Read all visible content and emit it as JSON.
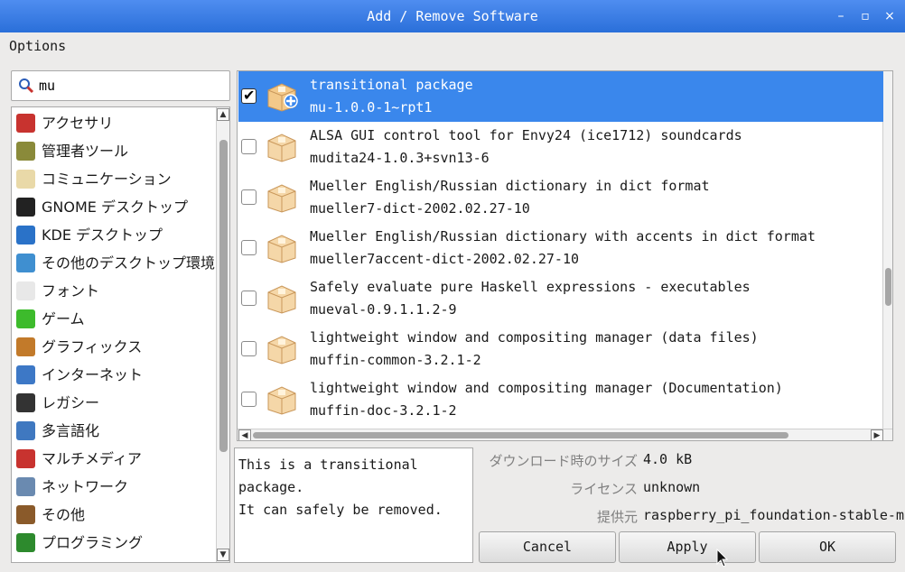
{
  "window": {
    "title": "Add / Remove Software",
    "minimize": "–",
    "maximize": "▫",
    "close": "×"
  },
  "menu": {
    "options": "Options"
  },
  "search": {
    "value": "mu"
  },
  "categories": [
    {
      "label": "アクセサリ",
      "icon": "pocket-knife-icon",
      "color": "#c8332f"
    },
    {
      "label": "管理者ツール",
      "icon": "admin-tools-icon",
      "color": "#8a8a3a"
    },
    {
      "label": "コミュニケーション",
      "icon": "communication-icon",
      "color": "#e9d9a8"
    },
    {
      "label": "GNOME デスクトップ",
      "icon": "gnome-foot-icon",
      "color": "#222222"
    },
    {
      "label": "KDE デスクトップ",
      "icon": "kde-icon",
      "color": "#2a72c8"
    },
    {
      "label": "その他のデスクトップ環境",
      "icon": "desktop-icon",
      "color": "#3f8fd0"
    },
    {
      "label": "フォント",
      "icon": "font-icon",
      "color": "#e8e8e8"
    },
    {
      "label": "ゲーム",
      "icon": "game-invader-icon",
      "color": "#3dbb2c"
    },
    {
      "label": "グラフィックス",
      "icon": "brush-icon",
      "color": "#c27a2a"
    },
    {
      "label": "インターネット",
      "icon": "globe-icon",
      "color": "#3d78c6"
    },
    {
      "label": "レガシー",
      "icon": "floppy-disk-icon",
      "color": "#333333"
    },
    {
      "label": "多言語化",
      "icon": "flag-icon",
      "color": "#3f78c0"
    },
    {
      "label": "マルチメディア",
      "icon": "popcorn-icon",
      "color": "#c8332f"
    },
    {
      "label": "ネットワーク",
      "icon": "network-icon",
      "color": "#6a8ab0"
    },
    {
      "label": "その他",
      "icon": "box-icon",
      "color": "#8a5a2a"
    },
    {
      "label": "プログラミング",
      "icon": "programming-icon",
      "color": "#2d8a2d"
    }
  ],
  "packages": [
    {
      "name": "transitional package",
      "version": "mu-1.0.0-1~rpt1",
      "checked": true,
      "selected": true
    },
    {
      "name": "ALSA GUI control tool for Envy24 (ice1712) soundcards",
      "version": "mudita24-1.0.3+svn13-6",
      "checked": false
    },
    {
      "name": "Mueller English/Russian dictionary in dict format",
      "version": "mueller7-dict-2002.02.27-10",
      "checked": false
    },
    {
      "name": "Mueller English/Russian dictionary with accents in dict format",
      "version": "mueller7accent-dict-2002.02.27-10",
      "checked": false
    },
    {
      "name": "Safely evaluate pure Haskell expressions - executables",
      "version": "mueval-0.9.1.1.2-9",
      "checked": false
    },
    {
      "name": "lightweight window and compositing manager (data files)",
      "version": "muffin-common-3.2.1-2",
      "checked": false
    },
    {
      "name": "lightweight window and compositing manager (Documentation)",
      "version": "muffin-doc-3.2.1-2",
      "checked": false
    }
  ],
  "description": {
    "line1": "This is a transitional package.",
    "line2": "It can safely be removed."
  },
  "info": {
    "download_size_label": "ダウンロード時のサイズ",
    "download_size": "4.0 kB",
    "license_label": "ライセンス",
    "license": "unknown",
    "provider_label": "提供元",
    "provider": "raspberry_pi_foundation-stable-main"
  },
  "buttons": {
    "cancel": "Cancel",
    "apply": "Apply",
    "ok": "OK"
  },
  "scrollbars": {
    "up": "▲",
    "down": "▼",
    "left": "◀",
    "right": "▶"
  }
}
